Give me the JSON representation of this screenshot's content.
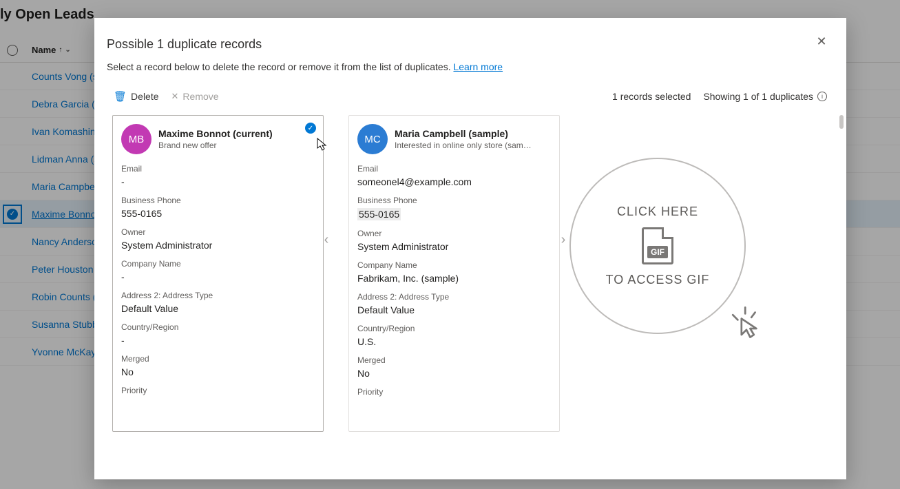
{
  "page": {
    "title": "ly Open Leads",
    "columnHeader": "Name"
  },
  "leads": [
    {
      "name": "Counts Vong (s",
      "selected": false,
      "current": false
    },
    {
      "name": "Debra Garcia (s",
      "selected": false,
      "current": false
    },
    {
      "name": "Ivan Komashins",
      "selected": false,
      "current": false
    },
    {
      "name": "Lidman Anna (s",
      "selected": false,
      "current": false
    },
    {
      "name": "Maria Campbel",
      "selected": false,
      "current": false
    },
    {
      "name": "Maxime Bonno",
      "selected": true,
      "current": true
    },
    {
      "name": "Nancy Anderso",
      "selected": false,
      "current": false
    },
    {
      "name": "Peter Houston (",
      "selected": false,
      "current": false
    },
    {
      "name": "Robin Counts (",
      "selected": false,
      "current": false
    },
    {
      "name": "Susanna Stubb",
      "selected": false,
      "current": false
    },
    {
      "name": "Yvonne McKay",
      "selected": false,
      "current": false
    }
  ],
  "modal": {
    "title": "Possible 1 duplicate records",
    "subtitle": "Select a record below to delete the record or remove it from the list of duplicates. ",
    "learnMore": "Learn more",
    "toolbar": {
      "delete": "Delete",
      "remove": "Remove",
      "selectedText": "1 records selected",
      "showingText": "Showing 1 of 1 duplicates"
    },
    "cards": [
      {
        "initials": "MB",
        "name": "Maxime Bonnot (current)",
        "sub": "Brand new offer",
        "avatarClass": "av-pink",
        "selected": true,
        "fields": {
          "Email": "-",
          "Business Phone": "555-0165",
          "Owner": "System Administrator",
          "Company Name": "-",
          "Address 2: Address Type": "Default Value",
          "Country/Region": "-",
          "Merged": "No",
          "Priority": ""
        }
      },
      {
        "initials": "MC",
        "name": "Maria Campbell (sample)",
        "sub": "Interested in online only store (sam…",
        "avatarClass": "av-blue",
        "selected": false,
        "fields": {
          "Email": "someonel4@example.com",
          "Business Phone": "555-0165",
          "Owner": "System Administrator",
          "Company Name": "Fabrikam, Inc. (sample)",
          "Address 2: Address Type": "Default Value",
          "Country/Region": "U.S.",
          "Merged": "No",
          "Priority": ""
        }
      }
    ]
  },
  "gif": {
    "top": "CLICK HERE",
    "label": "GIF",
    "bottom": "TO ACCESS GIF"
  },
  "fieldOrder": [
    "Email",
    "Business Phone",
    "Owner",
    "Company Name",
    "Address 2: Address Type",
    "Country/Region",
    "Merged",
    "Priority"
  ]
}
